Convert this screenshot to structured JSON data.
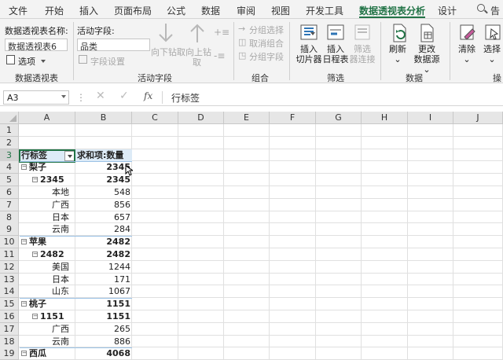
{
  "tabs": [
    "文件",
    "开始",
    "插入",
    "页面布局",
    "公式",
    "数据",
    "审阅",
    "视图",
    "开发工具",
    "数据透视表分析",
    "设计"
  ],
  "search_text": "告",
  "ribbon": {
    "pivot_table": {
      "name_label": "数据透视表名称:",
      "name_value": "数据透视表6",
      "options": "选项",
      "title": "数据透视表"
    },
    "active_field": {
      "label": "活动字段:",
      "value": "品类",
      "field_settings": "字段设置",
      "drill_down": "向下钻取",
      "drill_up_1": "向上钻",
      "drill_up_2": "取",
      "title": "活动字段"
    },
    "group": {
      "selection": "分组选择",
      "ungroup": "取消组合",
      "field": "分组字段",
      "title": "组合"
    },
    "filter": {
      "slicer_1": "插入",
      "slicer_2": "切片器",
      "timeline_1": "插入",
      "timeline_2": "日程表",
      "conn_1": "筛选",
      "conn_2": "器连接",
      "title": "筛选"
    },
    "data": {
      "refresh": "刷新",
      "change_1": "更改",
      "change_2": "数据源",
      "title": "数据"
    },
    "actions": {
      "clear": "清除",
      "select": "选择",
      "title": "操"
    }
  },
  "formula_bar": {
    "name_box": "A3",
    "fx": "fx",
    "value": "行标签"
  },
  "columns": [
    "A",
    "B",
    "C",
    "D",
    "E",
    "F",
    "G",
    "H",
    "I",
    "J"
  ],
  "rows": [
    "1",
    "2",
    "3",
    "4",
    "5",
    "6",
    "7",
    "8",
    "9",
    "10",
    "11",
    "12",
    "13",
    "14",
    "15",
    "16",
    "17",
    "18",
    "19"
  ],
  "pivot": {
    "header_label": "行标签",
    "header_value": "求和项:数量",
    "lines": [
      {
        "label": "梨子",
        "value": "2345"
      },
      {
        "label": "2345",
        "value": "2345"
      },
      {
        "label": "本地",
        "value": "548"
      },
      {
        "label": "广西",
        "value": "856"
      },
      {
        "label": "日本",
        "value": "657"
      },
      {
        "label": "云南",
        "value": "284"
      },
      {
        "label": "苹果",
        "value": "2482"
      },
      {
        "label": "2482",
        "value": "2482"
      },
      {
        "label": "美国",
        "value": "1244"
      },
      {
        "label": "日本",
        "value": "171"
      },
      {
        "label": "山东",
        "value": "1067"
      },
      {
        "label": "桃子",
        "value": "1151"
      },
      {
        "label": "1151",
        "value": "1151"
      },
      {
        "label": "广西",
        "value": "265"
      },
      {
        "label": "云南",
        "value": "886"
      },
      {
        "label": "西瓜",
        "value": "4068"
      }
    ]
  }
}
